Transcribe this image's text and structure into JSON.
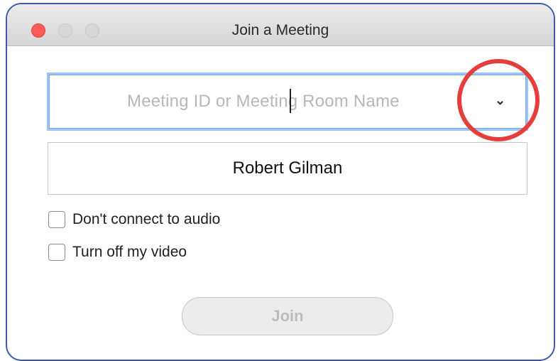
{
  "window": {
    "title": "Join a Meeting",
    "controls": [
      "close-button",
      "minimize-button",
      "maximize-button"
    ]
  },
  "meeting_input": {
    "placeholder": "Meeting ID or Meeting Room Name",
    "value": "",
    "dropdown_icon": "chevron-down-icon"
  },
  "name_input": {
    "value": "Robert Gilman"
  },
  "options": [
    {
      "label": "Don't connect to audio",
      "checked": false
    },
    {
      "label": "Turn off my video",
      "checked": false
    }
  ],
  "actions": {
    "join_label": "Join",
    "join_enabled": false
  },
  "annotation": {
    "shape": "red-circle",
    "color": "#e53d3a"
  }
}
